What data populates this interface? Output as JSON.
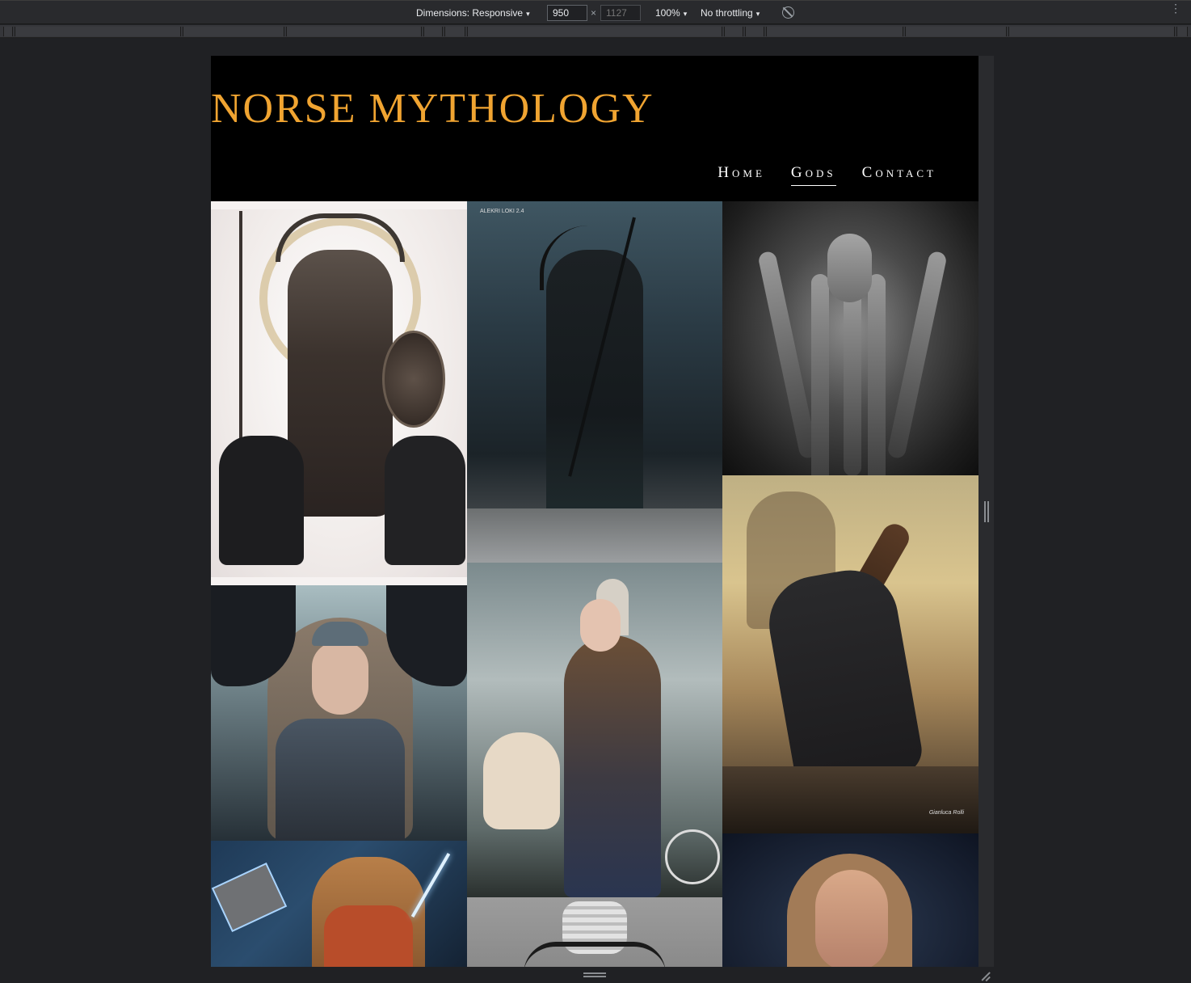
{
  "devtools": {
    "dimensions_label": "Dimensions: Responsive",
    "width_value": "950",
    "height_placeholder": "1127",
    "times": "×",
    "zoom": "100%",
    "throttling": "No throttling",
    "caret": "▾",
    "kebab": "⋮"
  },
  "site": {
    "title": "NORSE MYTHOLOGY",
    "title_color": "#f0a431",
    "nav": [
      {
        "label": "Home",
        "active": false
      },
      {
        "label": "Gods",
        "active": true
      },
      {
        "label": "Contact",
        "active": false
      }
    ]
  },
  "gallery": {
    "images": [
      {
        "subject": "Odin with wolves"
      },
      {
        "subject": "Loki",
        "caption": "ALEKRI LOKI 2.4"
      },
      {
        "subject": "Tree statue"
      },
      {
        "subject": "Freyja with ravens"
      },
      {
        "subject": "Valkyrie with cats"
      },
      {
        "subject": "Warrior blowing horn",
        "caption": "Gianluca Rolli"
      },
      {
        "subject": "Thor with hammer"
      },
      {
        "subject": "Ravens emblem"
      },
      {
        "subject": "Goddess portrait"
      }
    ]
  }
}
